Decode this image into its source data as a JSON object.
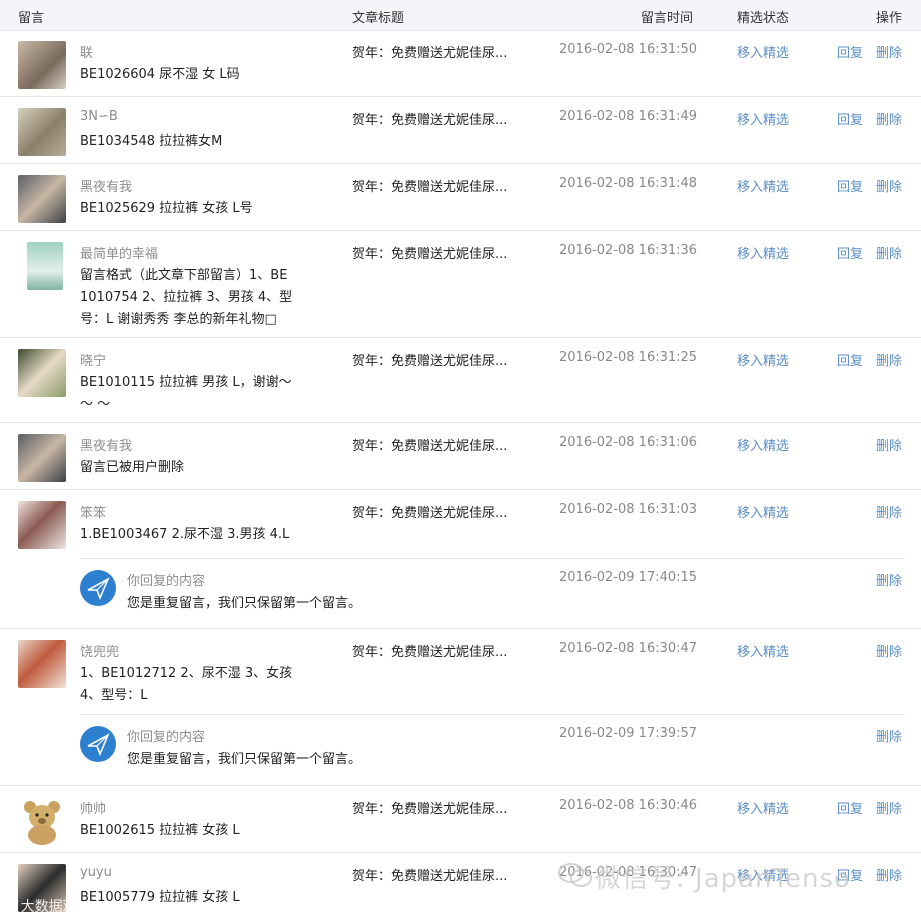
{
  "header": {
    "col_message": "留言",
    "col_article": "文章标题",
    "col_time": "留言时间",
    "col_feature": "精选状态",
    "col_action": "操作"
  },
  "rows": [
    {
      "nick": "联",
      "content": "BE1026604 尿不湿 女 L码",
      "article": "贺年：免费赠送尤妮佳尿...",
      "time": "2016-02-08 16:31:50",
      "feature": "移入精选",
      "reply": "回复",
      "delete": "删除"
    },
    {
      "nick": "3N∽B",
      "content": "BE1034548 拉拉裤女M",
      "article": "贺年：免费赠送尤妮佳尿...",
      "time": "2016-02-08 16:31:49",
      "feature": "移入精选",
      "reply": "回复",
      "delete": "删除"
    },
    {
      "nick": "黑夜有我",
      "content": "BE1025629 拉拉裤 女孩 L号",
      "article": "贺年：免费赠送尤妮佳尿...",
      "time": "2016-02-08 16:31:48",
      "feature": "移入精选",
      "reply": "回复",
      "delete": "删除"
    },
    {
      "nick": "最简单的幸福",
      "content": "留言格式（此文章下部留言）1、BE 1010754 2、拉拉裤 3、男孩 4、型号：L 谢谢秀秀 李总的新年礼物□",
      "article": "贺年：免费赠送尤妮佳尿...",
      "time": "2016-02-08 16:31:36",
      "feature": "移入精选",
      "reply": "回复",
      "delete": "删除"
    },
    {
      "nick": "晓宁",
      "content": "BE1010115 拉拉裤 男孩 L，谢谢～ ～ ～",
      "article": "贺年：免费赠送尤妮佳尿...",
      "time": "2016-02-08 16:31:25",
      "feature": "移入精选",
      "reply": "回复",
      "delete": "删除"
    },
    {
      "nick": "黑夜有我",
      "content": "留言已被用户删除",
      "article": "贺年：免费赠送尤妮佳尿...",
      "time": "2016-02-08 16:31:06",
      "feature": "移入精选",
      "reply": "",
      "delete": "删除"
    },
    {
      "nick": "笨笨",
      "content": "1.BE1003467 2.尿不湿 3.男孩 4.L",
      "article": "贺年：免费赠送尤妮佳尿...",
      "time": "2016-02-08 16:31:03",
      "feature": "移入精选",
      "reply": "",
      "delete": "删除",
      "sub": {
        "label": "你回复的内容",
        "text": "您是重复留言，我们只保留第一个留言。",
        "time": "2016-02-09 17:40:15",
        "delete": "删除"
      }
    },
    {
      "nick": "饶兜兜",
      "content": "1、BE1012712 2、尿不湿 3、女孩 4、型号：L",
      "article": "贺年：免费赠送尤妮佳尿...",
      "time": "2016-02-08 16:30:47",
      "feature": "移入精选",
      "reply": "",
      "delete": "删除",
      "sub": {
        "label": "你回复的内容",
        "text": "您是重复留言，我们只保留第一个留言。",
        "time": "2016-02-09 17:39:57",
        "delete": "删除"
      }
    },
    {
      "nick": "帅帅",
      "content": "BE1002615 拉拉裤 女孩 L",
      "article": "贺年：免费赠送尤妮佳尿...",
      "time": "2016-02-08 16:30:46",
      "feature": "移入精选",
      "reply": "回复",
      "delete": "删除"
    },
    {
      "nick": "yuyu",
      "content": "BE1005779 拉拉裤 女孩 L",
      "article": "贺年：免费赠送尤妮佳尿...",
      "time": "2016-02-08 16:30:47",
      "feature": "移入精选",
      "reply": "回复",
      "delete": "删除"
    }
  ],
  "watermark": {
    "text": "微信号: JapanTenso",
    "corner": "大数据观"
  },
  "colors": {
    "link": "#5a8ec7",
    "header_bg": "#f4f5f9",
    "muted": "#8d8d8d"
  }
}
